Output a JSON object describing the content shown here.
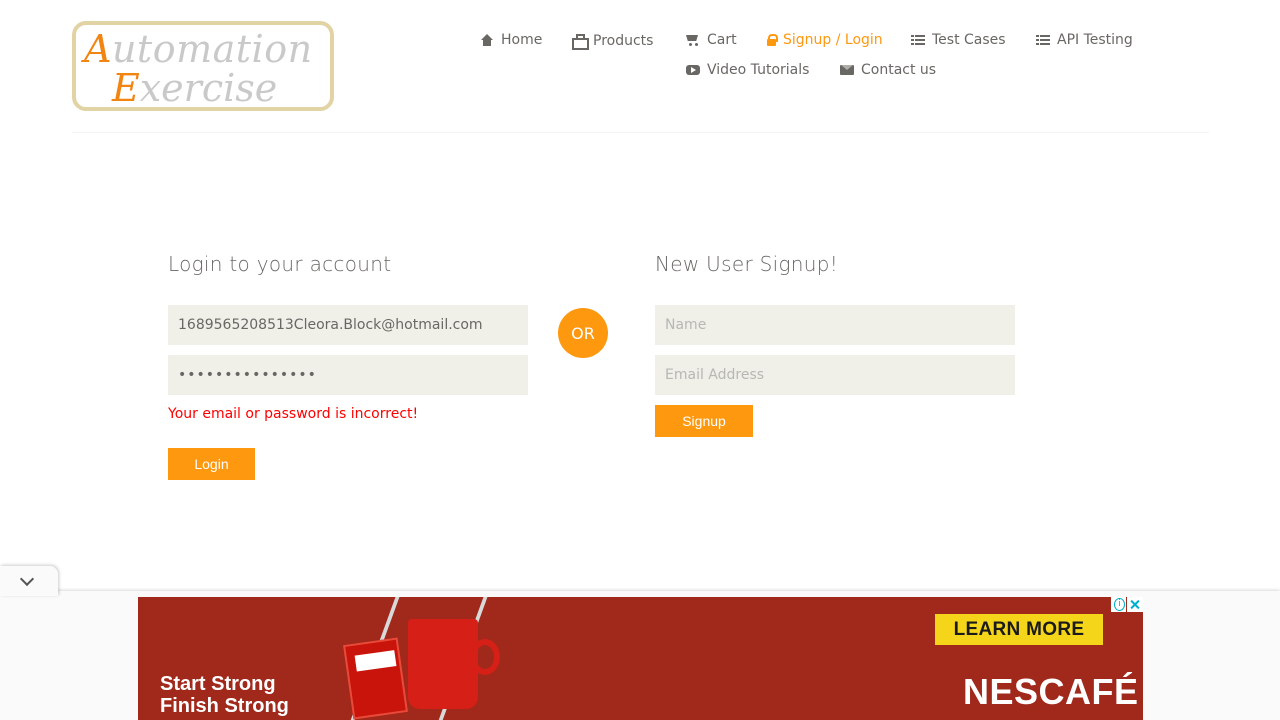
{
  "header": {
    "logo": {
      "line1_cap": "A",
      "line1_rest": "utomation",
      "line2_cap": "E",
      "line2_rest": "xercise"
    },
    "nav": [
      {
        "label": "Home",
        "icon": "home-icon"
      },
      {
        "label": "Products",
        "icon": "briefcase-icon"
      },
      {
        "label": "Cart",
        "icon": "shopping-cart-icon"
      },
      {
        "label": "Signup / Login",
        "icon": "lock-icon",
        "active": true
      },
      {
        "label": "Test Cases",
        "icon": "list-icon"
      },
      {
        "label": "API Testing",
        "icon": "list-icon"
      },
      {
        "label": "Video Tutorials",
        "icon": "youtube-play-icon"
      },
      {
        "label": "Contact us",
        "icon": "envelope-icon"
      }
    ]
  },
  "login": {
    "title": "Login to your account",
    "email_value": "1689565208513Cleora.Block@hotmail.com",
    "password_value": "•••••••••••••••",
    "error": "Your email or password is incorrect!",
    "button": "Login"
  },
  "divider": {
    "label": "OR"
  },
  "signup": {
    "title": "New User Signup!",
    "name_placeholder": "Name",
    "email_placeholder": "Email Address",
    "button": "Signup"
  },
  "ad": {
    "tagline_1": "Start Strong",
    "tagline_2": "Finish Strong",
    "cta": "LEARN MORE",
    "brand": "NESCAFÉ"
  },
  "colors": {
    "accent": "#fe980f",
    "error": "#ff0000",
    "field_bg": "#f0f0e9",
    "text": "#696763"
  }
}
